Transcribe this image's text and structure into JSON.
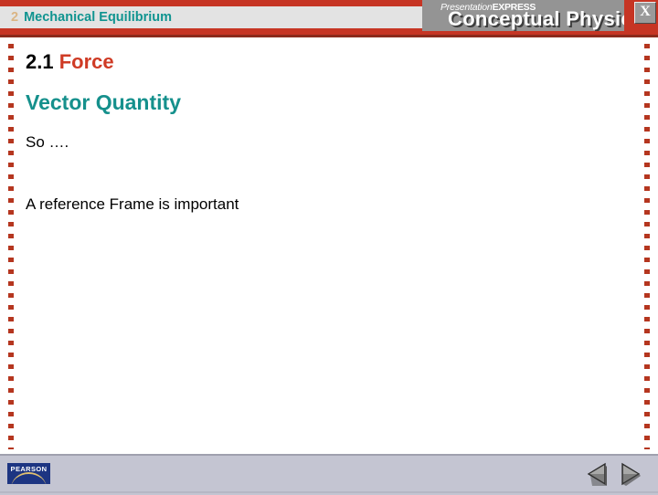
{
  "header": {
    "chapter_number": "2",
    "chapter_title": "Mechanical Equilibrium",
    "brand_prefix": "Presentation",
    "brand_suffix": "EXPRESS",
    "brand_product": "Conceptual Physics",
    "close_label": "X",
    "band_color": "#c63524",
    "plate_color": "#e3e3e3",
    "chapter_number_color": "#dbb584",
    "chapter_title_color": "#109490",
    "brand_box_color": "#949494"
  },
  "content": {
    "section_number": "2.1",
    "section_title": "Force",
    "section_title_color": "#cf3b25",
    "subheading": "Vector Quantity",
    "subheading_color": "#15908c",
    "body_line_1": "So ….",
    "body_line_2": "A reference Frame is important"
  },
  "decor": {
    "dot_rail_color": "#b5361f"
  },
  "footer": {
    "logo_text": "PEARSON",
    "logo_bg_color": "#1d3582",
    "bar_color": "#c4c5d2",
    "prev_label": "Previous slide",
    "next_label": "Next slide"
  }
}
